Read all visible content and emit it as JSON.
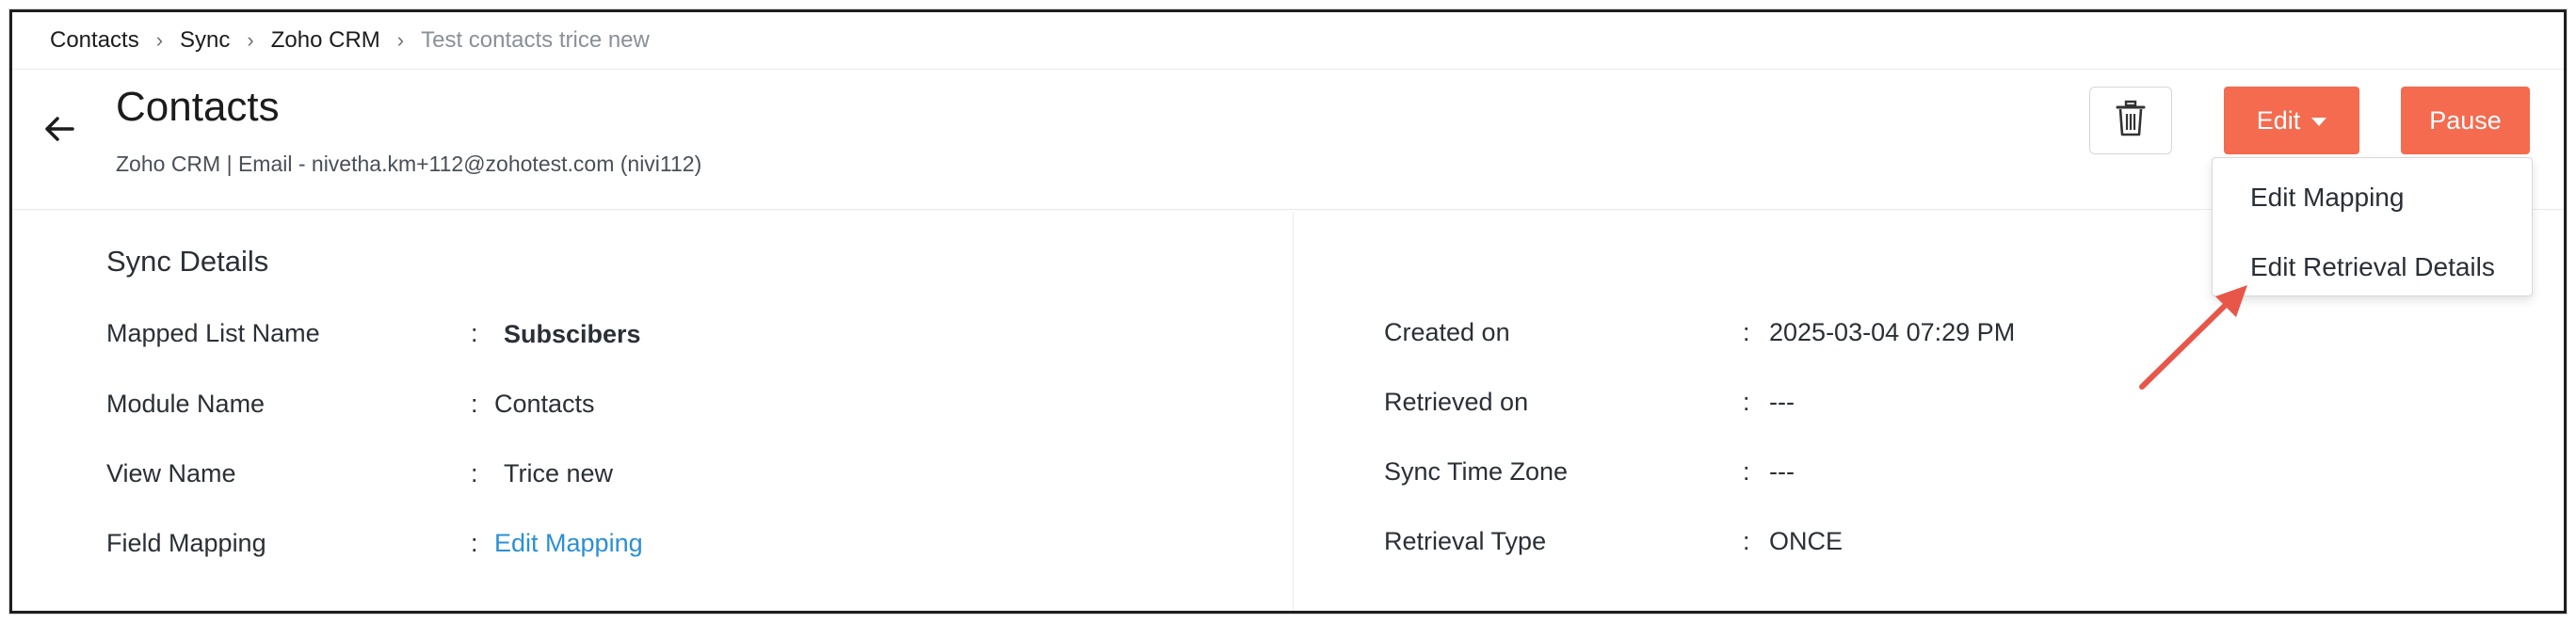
{
  "breadcrumb": [
    {
      "label": "Contacts"
    },
    {
      "label": "Sync"
    },
    {
      "label": "Zoho CRM"
    },
    {
      "label": "Test contacts trice new"
    }
  ],
  "header": {
    "title": "Contacts",
    "subtitle": "Zoho CRM | Email - nivetha.km+112@zohotest.com (nivi112)",
    "edit_label": "Edit",
    "pause_label": "Pause"
  },
  "dropdown": {
    "items": [
      {
        "label": "Edit Mapping"
      },
      {
        "label": "Edit Retrieval Details"
      }
    ]
  },
  "sync_details": {
    "title": "Sync Details",
    "left_rows": [
      {
        "label": "Mapped List Name",
        "value": "Subscibers"
      },
      {
        "label": "Module Name",
        "value": "Contacts"
      },
      {
        "label": "View Name",
        "value": "Trice new"
      },
      {
        "label": "Field Mapping",
        "value": "Edit Mapping"
      }
    ],
    "right_rows": [
      {
        "label": "Created on",
        "value": "2025-03-04 07:29 PM"
      },
      {
        "label": "Retrieved on",
        "value": "---"
      },
      {
        "label": "Sync Time Zone",
        "value": "---"
      },
      {
        "label": "Retrieval Type",
        "value": "ONCE"
      }
    ]
  },
  "colors": {
    "accent": "#f46b4f",
    "link": "#2b8fd6",
    "annotation_arrow": "#e8564a"
  },
  "icons": {
    "back": "arrow-left-icon",
    "trash": "trash-icon",
    "caret": "caret-down-icon",
    "breadcrumb_sep": "chevron-right-icon"
  }
}
